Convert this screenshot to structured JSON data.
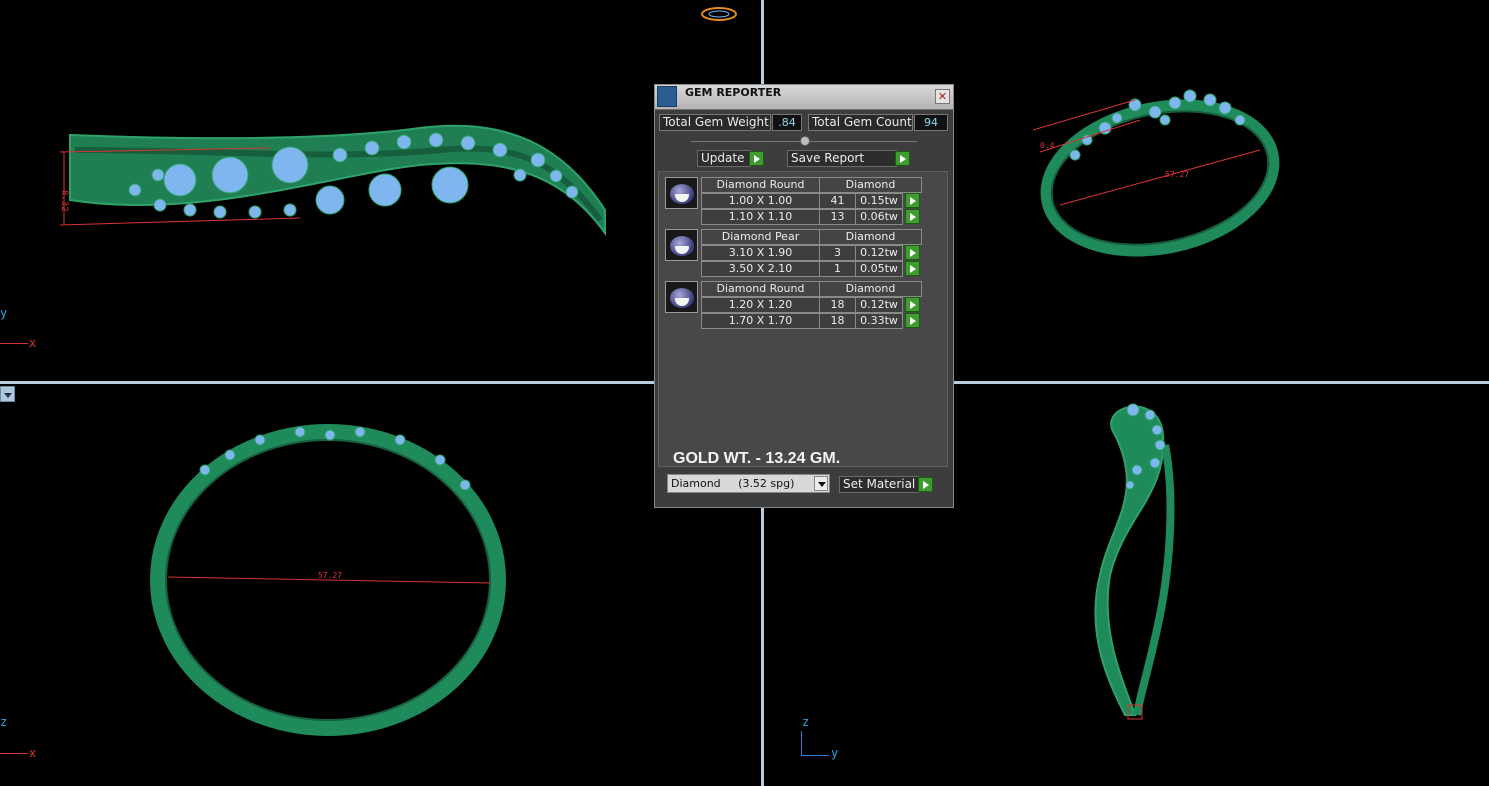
{
  "panel": {
    "title": "GEM REPORTER",
    "close_label": "✕",
    "total_gem_weight_label": "Total Gem Weight",
    "total_gem_weight_value": ".84",
    "total_gem_count_label": "Total Gem Count",
    "total_gem_count_value": "94",
    "update_label": "Update",
    "save_report_label": "Save Report",
    "groups": [
      {
        "shape": "Diamond Round",
        "material": "Diamond",
        "rows": [
          {
            "size": "1.00 X 1.00",
            "count": "41",
            "weight": "0.15tw"
          },
          {
            "size": "1.10 X 1.10",
            "count": "13",
            "weight": "0.06tw"
          }
        ]
      },
      {
        "shape": "Diamond Pear",
        "material": "Diamond",
        "rows": [
          {
            "size": "3.10 X 1.90",
            "count": "3",
            "weight": "0.12tw"
          },
          {
            "size": "3.50 X 2.10",
            "count": "1",
            "weight": "0.05tw"
          }
        ]
      },
      {
        "shape": "Diamond Round",
        "material": "Diamond",
        "rows": [
          {
            "size": "1.20 X 1.20",
            "count": "18",
            "weight": "0.12tw"
          },
          {
            "size": "1.70 X 1.70",
            "count": "18",
            "weight": "0.33tw"
          }
        ]
      }
    ],
    "note": "GOLD WT. - 13.24 GM.",
    "material_select": "Diamond     (3.52 spg)",
    "set_material_label": "Set Material"
  },
  "viewports": {
    "top_left": {
      "axis_y": "y",
      "axis_x": "x",
      "dimension": "8.32"
    },
    "top_right": {
      "dimension_a": "0.4",
      "dimension_b": "57.27"
    },
    "bottom_left": {
      "axis_z": "z",
      "axis_x": "x",
      "dimension": "57.27"
    },
    "bottom_right": {
      "axis_z": "z",
      "axis_y": "y",
      "dimension": "0.46"
    }
  },
  "colors": {
    "metal": "#1f8a5a",
    "gem": "#7fb6f0",
    "dimension": "#d83434",
    "panel_bg": "#3d3d3d"
  }
}
